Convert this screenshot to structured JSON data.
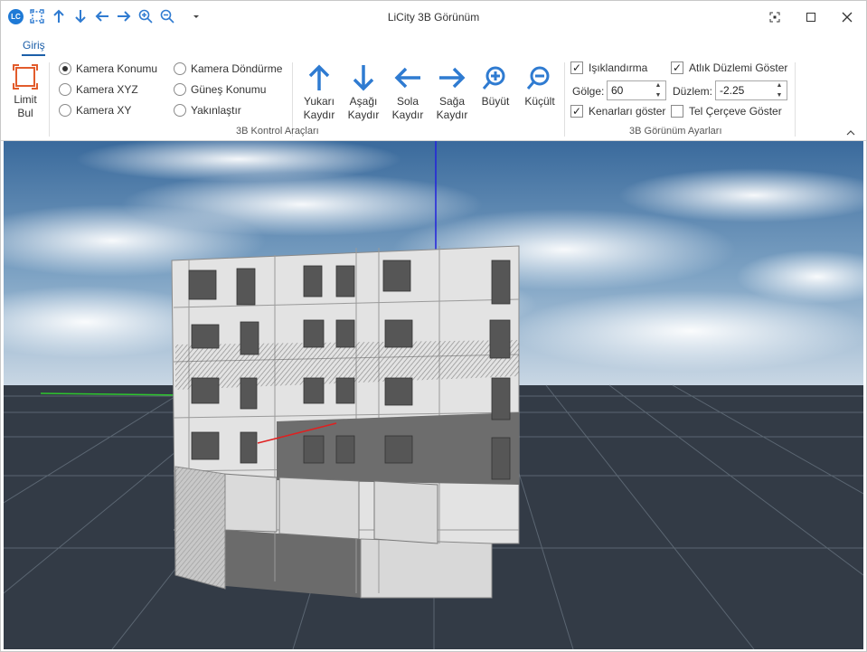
{
  "app": {
    "title": "LiCity 3B Görünüm",
    "logo_text": "LC"
  },
  "quick_access": {
    "icons": [
      "logo-icon",
      "limit-icon",
      "arrow-up-icon",
      "arrow-down-icon",
      "arrow-left-icon",
      "arrow-right-icon",
      "zoom-in-icon",
      "zoom-out-icon",
      "dropdown-icon"
    ]
  },
  "tabs": [
    {
      "label": "Giriş",
      "active": true
    }
  ],
  "ribbon": {
    "limit_button": {
      "line1": "Limit",
      "line2": "Bul"
    },
    "camera_options": [
      {
        "label": "Kamera Konumu",
        "selected": true
      },
      {
        "label": "Kamera XYZ",
        "selected": false
      },
      {
        "label": "Kamera XY",
        "selected": false
      },
      {
        "label": "Kamera Döndürme",
        "selected": false
      },
      {
        "label": "Güneş Konumu",
        "selected": false
      },
      {
        "label": "Yakınlaştır",
        "selected": false
      }
    ],
    "nav_buttons": [
      {
        "line1": "Yukarı",
        "line2": "Kaydır",
        "icon": "arrow-up-icon"
      },
      {
        "line1": "Aşağı",
        "line2": "Kaydır",
        "icon": "arrow-down-icon"
      },
      {
        "line1": "Sola",
        "line2": "Kaydır",
        "icon": "arrow-left-icon"
      },
      {
        "line1": "Sağa",
        "line2": "Kaydır",
        "icon": "arrow-right-icon"
      },
      {
        "line1": "Büyüt",
        "line2": "",
        "icon": "zoom-in-icon"
      },
      {
        "line1": "Küçült",
        "line2": "",
        "icon": "zoom-out-icon"
      }
    ],
    "group1_label": "3B Kontrol Araçları",
    "settings": {
      "lighting_label": "Işıklandırma",
      "lighting_checked": true,
      "shadow_label": "Gölge:",
      "shadow_value": "60",
      "edges_label": "Kenarları göster",
      "edges_checked": true,
      "plane_label": "Atlık Düzlemi Göster",
      "plane_checked": true,
      "level_label": "Düzlem:",
      "level_value": "-2.25",
      "wireframe_label": "Tel Çerçeve Göster",
      "wireframe_checked": false
    },
    "group2_label": "3B Görünüm Ayarları"
  },
  "colors": {
    "accent": "#1c5fa8",
    "icon_blue": "#2f7bd1",
    "limit_orange": "#e25c2c",
    "axis_x": "#e02020",
    "axis_y": "#2ec62e",
    "axis_z": "#2222dd",
    "ground": "#333b46",
    "grid": "#5b6672"
  }
}
